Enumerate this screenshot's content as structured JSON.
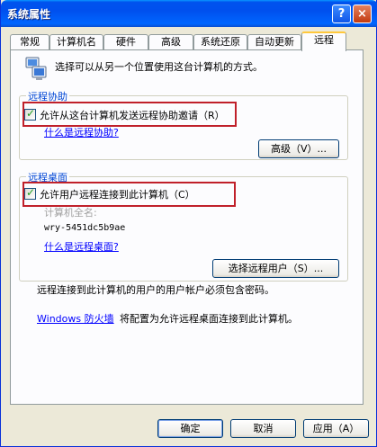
{
  "window": {
    "title": "系统属性",
    "help_glyph": "?",
    "close_glyph": "×"
  },
  "tabs": [
    {
      "label": "常规"
    },
    {
      "label": "计算机名"
    },
    {
      "label": "硬件"
    },
    {
      "label": "高级"
    },
    {
      "label": "系统还原"
    },
    {
      "label": "自动更新"
    },
    {
      "label": "远程"
    }
  ],
  "intro": {
    "icon": "remote-computers-icon",
    "text": "选择可以从另一个位置使用这台计算机的方式。"
  },
  "remote_assistance": {
    "group_title": "远程协助",
    "checkbox_label": "允许从这台计算机发送远程协助邀请（R）",
    "checked": true,
    "link": "什么是远程协助?",
    "advanced_button": "高级（V）..."
  },
  "remote_desktop": {
    "group_title": "远程桌面",
    "checkbox_label": "允许用户远程连接到此计算机（C）",
    "checked": true,
    "computer_name_label": "计算机全名:",
    "computer_name": "wry-5451dc5b9ae",
    "link": "什么是远程桌面?",
    "select_users_button": "选择远程用户（S）...",
    "password_note": "远程连接到此计算机的用户的用户帐户必须包含密码。"
  },
  "firewall": {
    "link": "Windows 防火墙",
    "text": "将配置为允许远程桌面连接到此计算机。"
  },
  "footer": {
    "ok": "确定",
    "cancel": "取消",
    "apply": "应用（A）"
  },
  "colors": {
    "titlebar": "#0053ee",
    "group_title": "#0046d5",
    "link": "#0000ff",
    "highlight": "#c0202a"
  }
}
